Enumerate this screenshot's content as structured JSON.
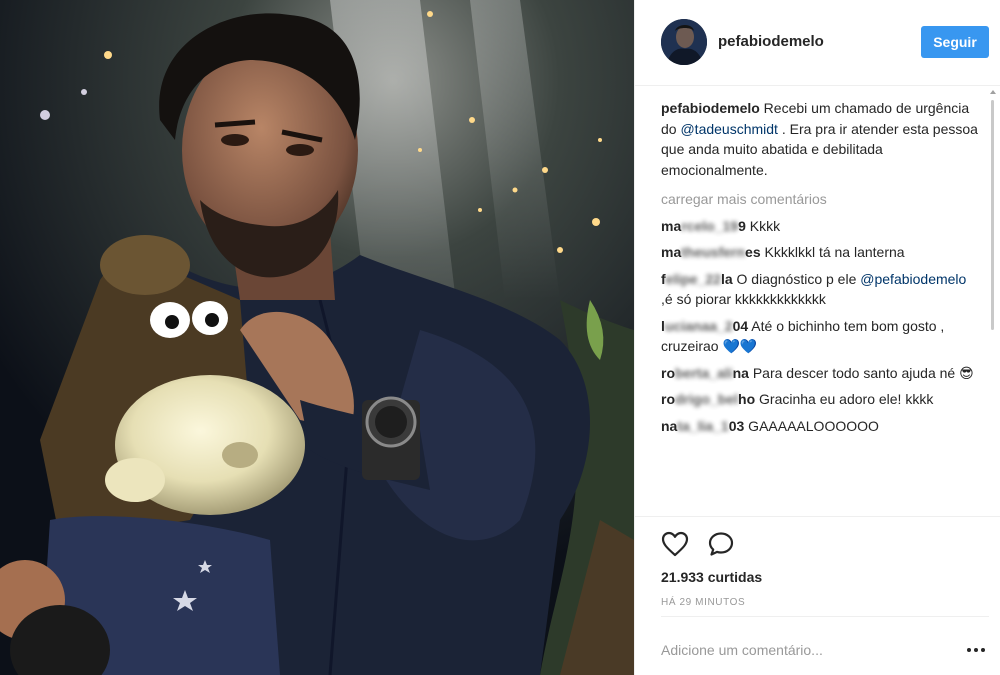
{
  "post": {
    "username": "pefabiodemelo",
    "follow_label": "Seguir",
    "caption": {
      "username": "pefabiodemelo",
      "text_before": " Recebi um chamado de urgência do ",
      "mention": "@tadeuschmidt",
      "text_after": " . Era pra ir atender esta pessoa que anda muito abatida e debilitada emocionalmente."
    },
    "load_more_label": "carregar mais comentários",
    "comments": [
      {
        "user_visible_start": "ma",
        "user_hidden": "rcelo_19",
        "user_visible_end": "9",
        "text": " Kkkk"
      },
      {
        "user_visible_start": "ma",
        "user_hidden": "theusfern",
        "user_visible_end": "es",
        "text": " Kkkklkkl tá na lanterna"
      },
      {
        "user_visible_start": "f",
        "user_hidden": "elipe_22",
        "user_visible_end": "la",
        "text_before": " O diagnóstico p ele ",
        "mention": "@pefabiodemelo",
        "text_after": " ,é só piorar kkkkkkkkkkkkk"
      },
      {
        "user_visible_start": "l",
        "user_hidden": "ucianaa_2",
        "user_visible_end": "04",
        "text": " Até o bichinho tem bom gosto , cruzeirao 💙💙"
      },
      {
        "user_visible_start": "ro",
        "user_hidden": "berta_ali",
        "user_visible_end": "na",
        "text": " Para descer todo santo ajuda né 😎"
      },
      {
        "user_visible_start": "ro",
        "user_hidden": "drigo_bel",
        "user_visible_end": "ho",
        "text": " Gracinha eu adoro ele! kkkk"
      },
      {
        "user_visible_start": "na",
        "user_hidden": "ta_lia_1",
        "user_visible_end": "03",
        "text": " GAAAAALOOOOOO"
      }
    ],
    "likes": "21.933 curtidas",
    "time": "HÁ 29 MINUTOS",
    "add_comment_placeholder": "Adicione um comentário...",
    "icons": {
      "like": "heart-outline-icon",
      "comment": "speech-bubble-icon",
      "more": "ellipsis-icon"
    },
    "colors": {
      "follow_button": "#3897f0",
      "mention": "#003569",
      "muted": "#999999",
      "text": "#262626"
    }
  }
}
